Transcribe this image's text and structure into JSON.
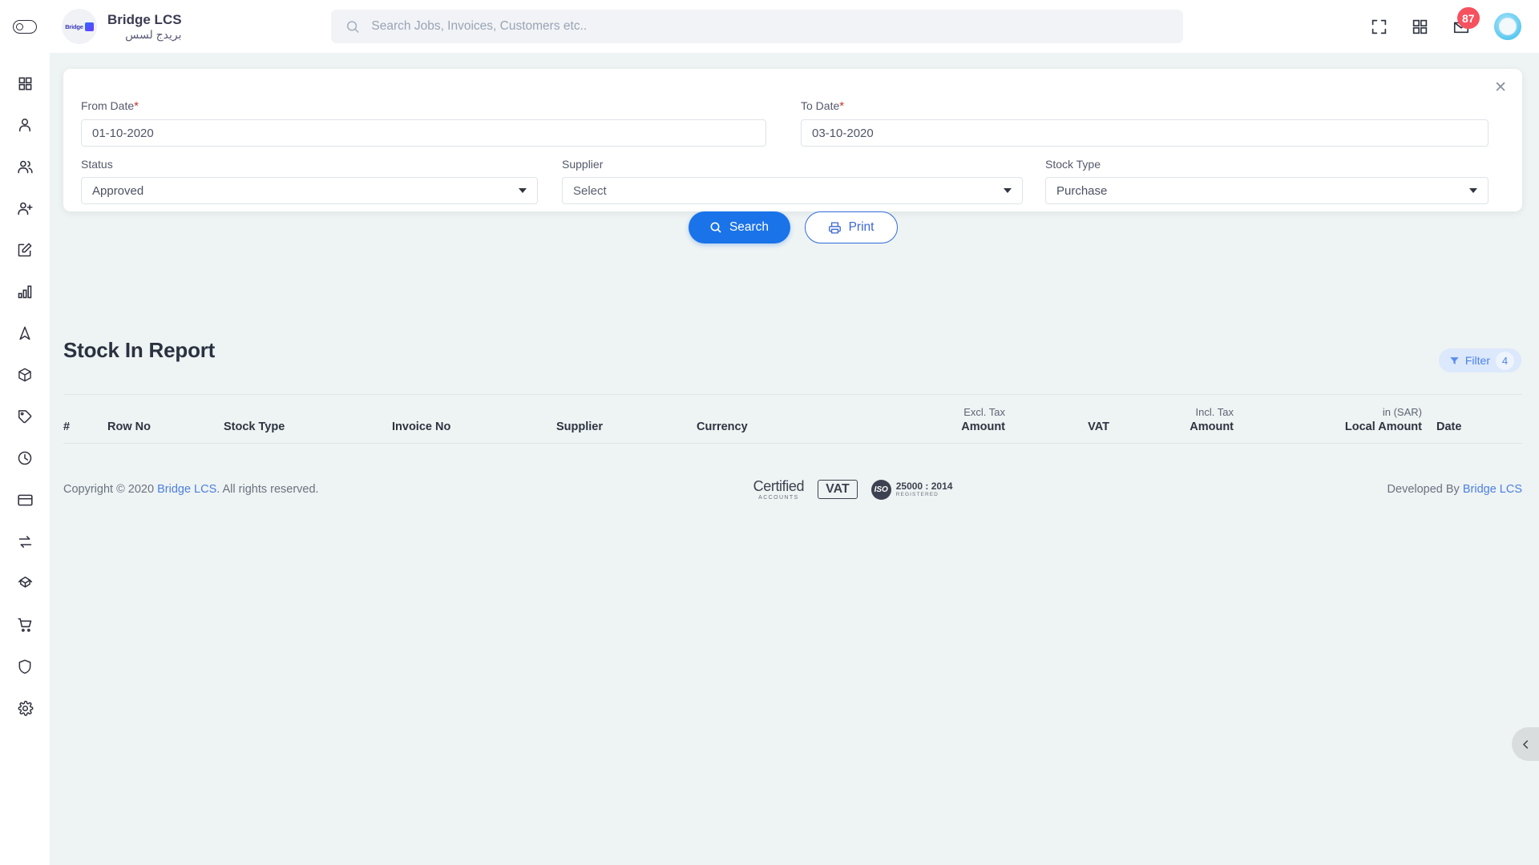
{
  "topbar": {
    "sidebar_toggle": "sidebar-toggle",
    "brand_en": "Bridge LCS",
    "brand_ar": "بريدج لسس",
    "logo_text": "Bridge",
    "search_placeholder": "Search Jobs, Invoices, Customers etc..",
    "search_value": "",
    "notification_count": "87"
  },
  "sidebar": {
    "items": [
      {
        "name": "dashboard",
        "icon": "grid-icon"
      },
      {
        "name": "profile",
        "icon": "user-icon"
      },
      {
        "name": "customers",
        "icon": "users-icon"
      },
      {
        "name": "add-user",
        "icon": "user-plus-icon"
      },
      {
        "name": "jobs",
        "icon": "edit-square-icon"
      },
      {
        "name": "reports",
        "icon": "bar-chart-icon"
      },
      {
        "name": "tracking",
        "icon": "navigation-icon"
      },
      {
        "name": "stock",
        "icon": "package-icon"
      },
      {
        "name": "pricing",
        "icon": "tag-icon"
      },
      {
        "name": "history",
        "icon": "clock-icon"
      },
      {
        "name": "payments",
        "icon": "credit-card-icon"
      },
      {
        "name": "transfers",
        "icon": "exchange-icon"
      },
      {
        "name": "assets",
        "icon": "cube-icon"
      },
      {
        "name": "purchase",
        "icon": "shopping-cart-icon"
      },
      {
        "name": "security",
        "icon": "shield-icon"
      },
      {
        "name": "settings",
        "icon": "gear-icon"
      }
    ]
  },
  "filter_form": {
    "close_label": "✕",
    "from_date": {
      "label": "From Date",
      "required": "*",
      "value": "01-10-2020",
      "placeholder": ""
    },
    "to_date": {
      "label": "To Date",
      "required": "*",
      "value": "03-10-2020",
      "placeholder": ""
    },
    "status": {
      "label": "Status",
      "value": "Approved"
    },
    "supplier": {
      "label": "Supplier",
      "value": "Select"
    },
    "stock_type": {
      "label": "Stock Type",
      "value": "Purchase"
    }
  },
  "actions": {
    "search_label": "Search",
    "print_label": "Print"
  },
  "report": {
    "title": "Stock In Report",
    "filter_label": "Filter",
    "filter_count": "4",
    "columns": [
      {
        "sub": "",
        "label": "#",
        "align": "left"
      },
      {
        "sub": "",
        "label": "Row No",
        "align": "left"
      },
      {
        "sub": "",
        "label": "Stock Type",
        "align": "left"
      },
      {
        "sub": "",
        "label": "Invoice No",
        "align": "left"
      },
      {
        "sub": "",
        "label": "Supplier",
        "align": "left"
      },
      {
        "sub": "",
        "label": "Currency",
        "align": "left"
      },
      {
        "sub": "Excl. Tax",
        "label": "Amount",
        "align": "right"
      },
      {
        "sub": "",
        "label": "VAT",
        "align": "right"
      },
      {
        "sub": "Incl. Tax",
        "label": "Amount",
        "align": "right"
      },
      {
        "sub": "in (SAR)",
        "label": "Local Amount",
        "align": "right"
      },
      {
        "sub": "",
        "label": "Date",
        "align": "right"
      }
    ],
    "rows": []
  },
  "footer": {
    "copyright_pre": "Copyright © 2020 ",
    "copyright_link": "Bridge LCS",
    "copyright_post": ". All rights reserved.",
    "certified_main": "Certified",
    "certified_sub": "ACCOUNTS",
    "vat_badge": "VAT",
    "iso_seal": "ISO",
    "iso_main": "25000 : 2014",
    "iso_sub": "REGISTERED",
    "developed_pre": "Developed By ",
    "developed_link": "Bridge LCS"
  },
  "edge_tab": {
    "icon": "chevron-left-icon"
  },
  "colors": {
    "accent": "#1a73e8",
    "badge": "#f5515f",
    "chip_bg": "#dce8fb",
    "page_bg": "#eef3f3"
  }
}
